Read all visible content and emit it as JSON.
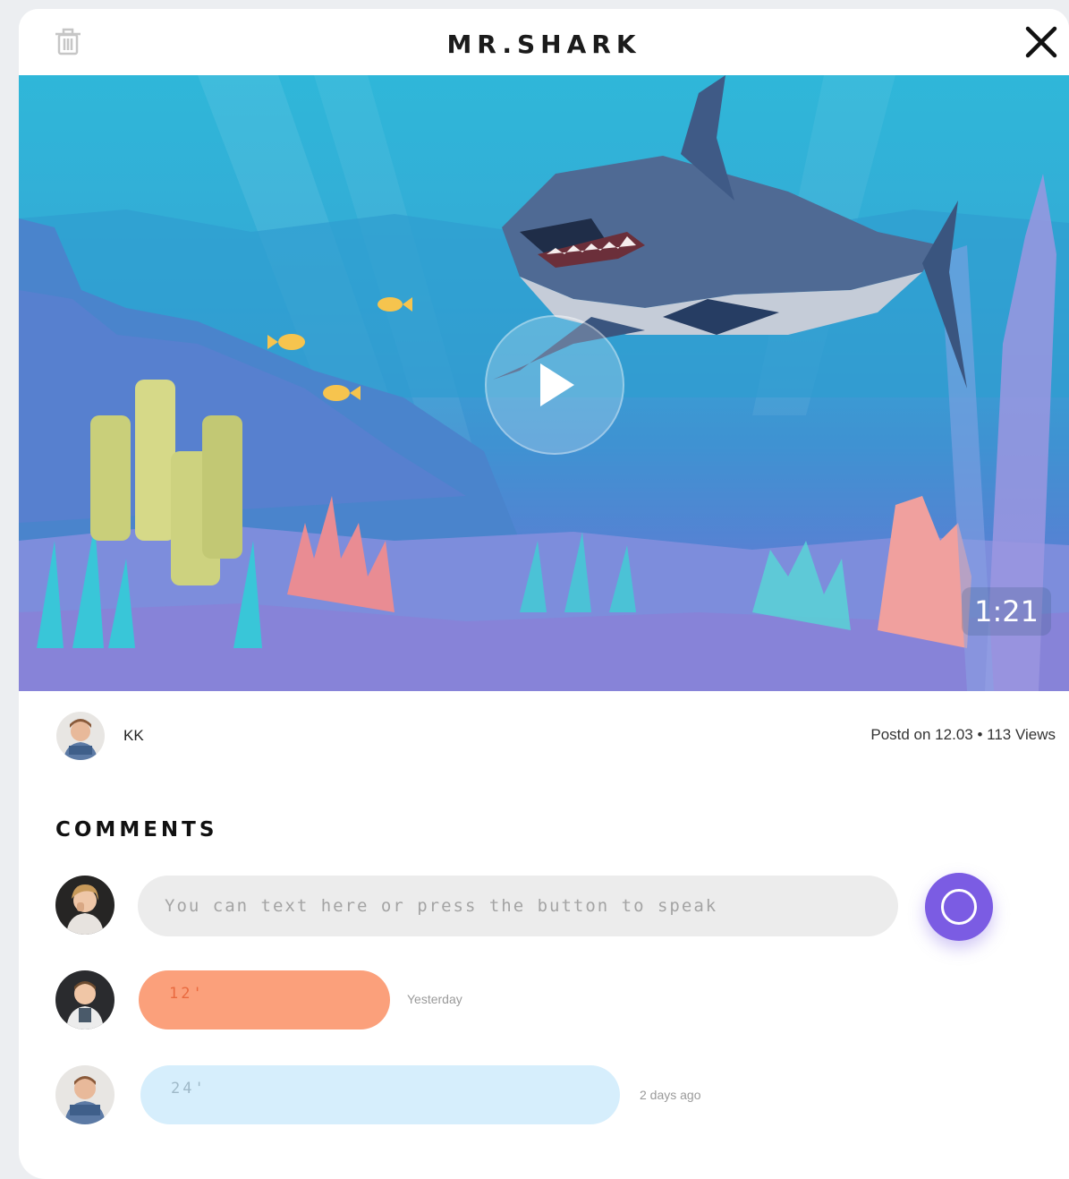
{
  "header": {
    "title": "MR.SHARK"
  },
  "video": {
    "duration": "1:21"
  },
  "post": {
    "author": "KK",
    "meta": "Postd on 12.03 • 113 Views"
  },
  "comments": {
    "heading": "COMMENTS",
    "input_placeholder": "You can text here or press the button to speak",
    "items": [
      {
        "label": "12'",
        "time": "Yesterday",
        "color": "#fba07b"
      },
      {
        "label": "24'",
        "time": "2 days ago",
        "color": "#d6eefc"
      }
    ]
  },
  "colors": {
    "mic_button": "#7b5ce3",
    "input_bg": "#ececec"
  }
}
